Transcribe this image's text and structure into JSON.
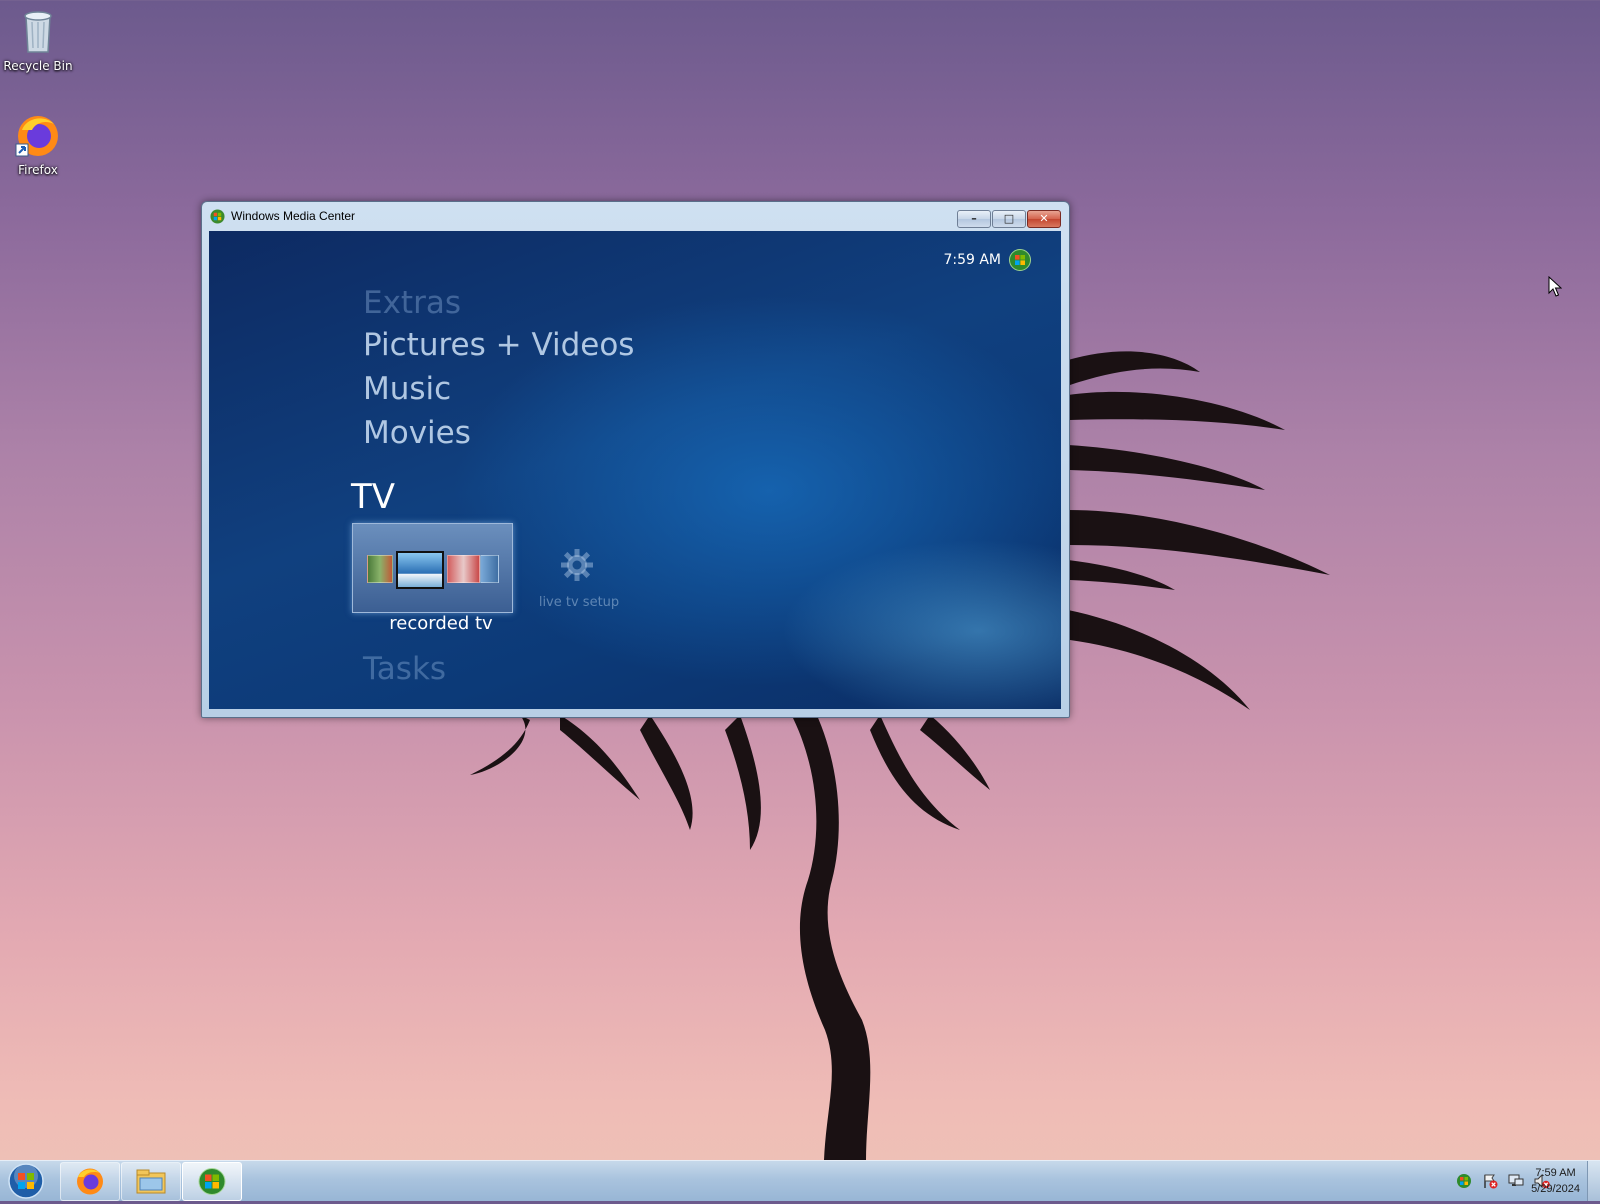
{
  "desktop": {
    "icons": [
      {
        "label": "Recycle Bin",
        "icon": "recycle-bin-icon"
      },
      {
        "label": "Firefox",
        "icon": "firefox-icon"
      }
    ]
  },
  "window": {
    "title": "Windows Media Center",
    "buttons": {
      "minimize": "–",
      "maximize": "□",
      "close": "✕"
    }
  },
  "media_center": {
    "clock": "7:59 AM",
    "menu": {
      "extras": "Extras",
      "pictures_videos": "Pictures + Videos",
      "music": "Music",
      "movies": "Movies",
      "tv": "TV",
      "tasks": "Tasks"
    },
    "tv_tiles": {
      "recorded": "recorded tv",
      "live_setup": "live tv setup"
    }
  },
  "taskbar": {
    "time": "7:59 AM",
    "date": "5/29/2024",
    "pinned": [
      "firefox-icon",
      "file-explorer-icon",
      "windows-media-center-icon"
    ]
  }
}
